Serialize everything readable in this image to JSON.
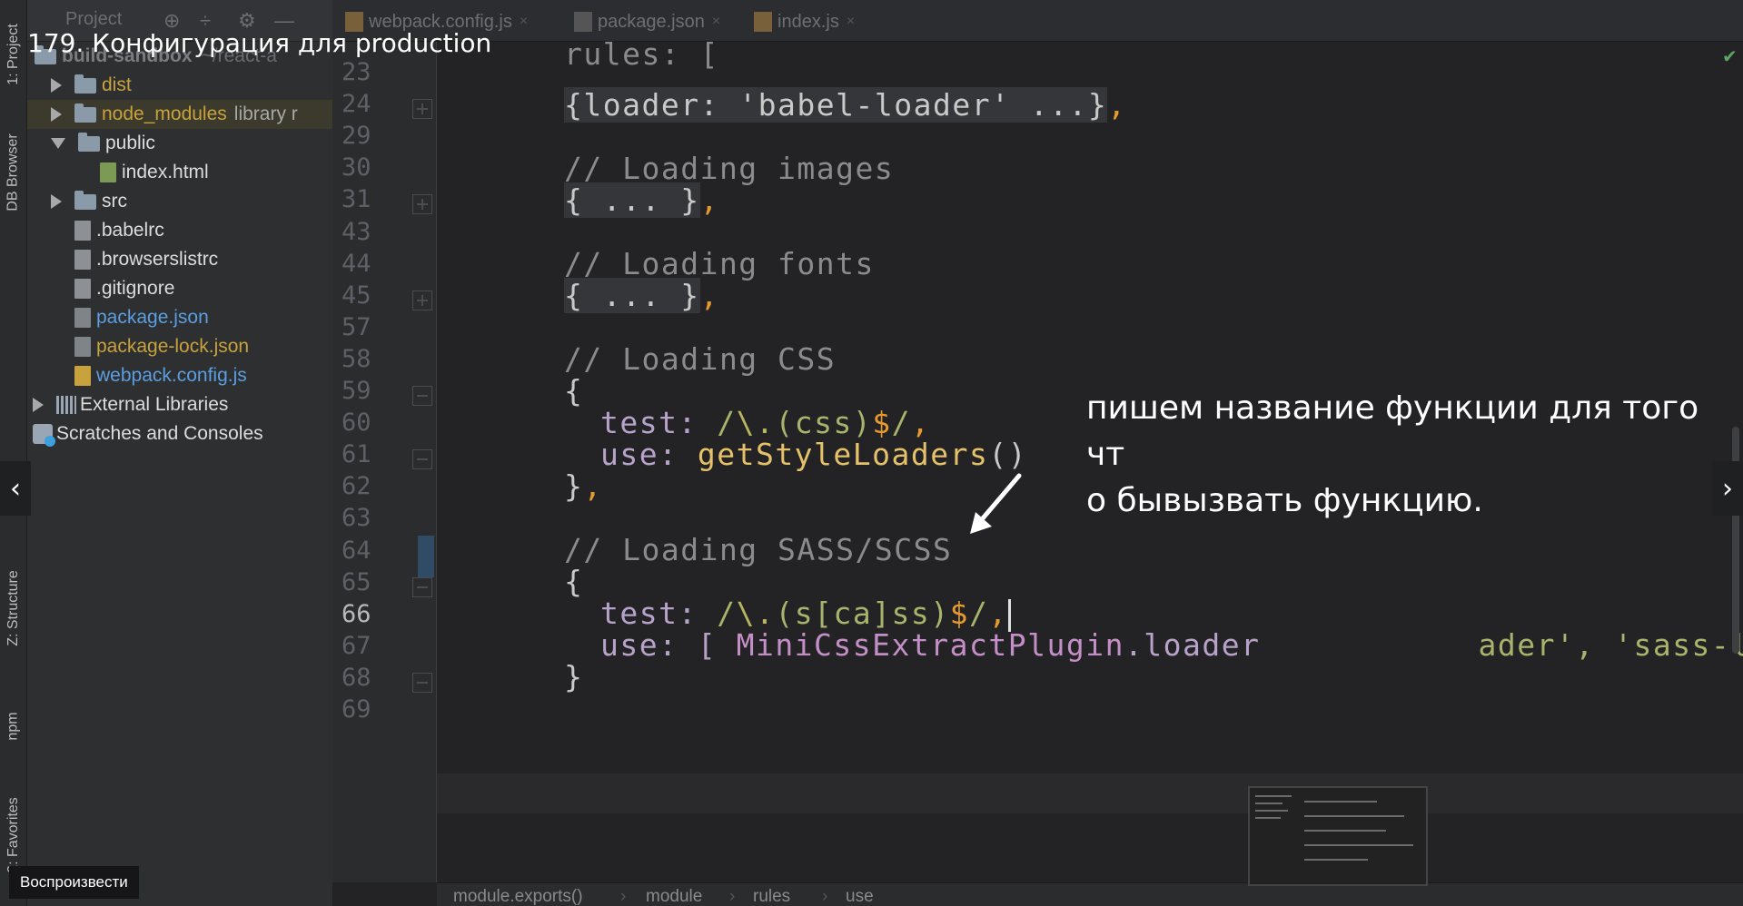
{
  "video": {
    "title": "179. Конфигурация для production",
    "annotation_line1": "пишем название функции для того чт",
    "annotation_line2": "о бывызвать функцию.",
    "play_label": "Воспроизвести"
  },
  "toolstrip": {
    "tabs": [
      "1: Project",
      "DB Browser",
      "Z: Structure",
      "npm",
      "2: Favorites"
    ]
  },
  "project": {
    "toolbar_label": "Project",
    "root_label": "build-sandbox",
    "root_path": "~/react-a",
    "tree": [
      {
        "label": "dist",
        "type": "folder",
        "expanded": false,
        "color": "#c8a23c"
      },
      {
        "label": "node_modules",
        "suffix": "library r",
        "type": "folder",
        "expanded": false,
        "color": "#c8a23c"
      },
      {
        "label": "public",
        "type": "folder",
        "expanded": true,
        "color": "#dcdcdc"
      },
      {
        "label": "index.html",
        "type": "file-html",
        "color": "#dcdcdc"
      },
      {
        "label": "src",
        "type": "folder",
        "expanded": false,
        "color": "#dcdcdc"
      },
      {
        "label": ".babelrc",
        "type": "file",
        "color": "#dcdcdc"
      },
      {
        "label": ".browserslistrc",
        "type": "file",
        "color": "#dcdcdc"
      },
      {
        "label": ".gitignore",
        "type": "file",
        "color": "#dcdcdc"
      },
      {
        "label": "package.json",
        "type": "file-json",
        "color": "#5d9ee0"
      },
      {
        "label": "package-lock.json",
        "type": "file-json",
        "color": "#c8a23c"
      },
      {
        "label": "webpack.config.js",
        "type": "file-js",
        "color": "#5d9ee0"
      },
      {
        "label": "External Libraries",
        "type": "lib",
        "color": "#dcdcdc"
      },
      {
        "label": "Scratches and Consoles",
        "type": "scratch",
        "color": "#dcdcdc"
      }
    ]
  },
  "tabs": [
    {
      "label": "webpack.config.js",
      "active": true
    },
    {
      "label": "package.json",
      "active": false
    },
    {
      "label": "index.js",
      "active": false
    }
  ],
  "gutter": {
    "lines": [
      "23",
      "24",
      "29",
      "30",
      "31",
      "43",
      "44",
      "45",
      "57",
      "58",
      "59",
      "60",
      "61",
      "62",
      "63",
      "64",
      "65",
      "66",
      "67",
      "68",
      "69"
    ],
    "current": "66"
  },
  "code": {
    "l_top": "rules: [",
    "l24_a": "{loader: 'babel-loader' ...}",
    "l24_b": ",",
    "l30": "// Loading images",
    "l31_a": "{ ... }",
    "l31_b": ",",
    "l44": "// Loading fonts",
    "l45_a": "{ ... }",
    "l45_b": ",",
    "l58": "// Loading CSS",
    "l59": "{",
    "l60_key": "test: ",
    "l60_r1": "/",
    "l60_r2": "\\.",
    "l60_r3": "(css)",
    "l60_r4": "$",
    "l60_r5": "/",
    "l60_end": ",",
    "l61_key": "use: ",
    "l61_fn": "getStyleLoaders",
    "l61_paren": "()",
    "l62_a": "}",
    "l62_b": ",",
    "l64": "// Loading SASS/SCSS",
    "l65": "{",
    "l66_key": "test: ",
    "l66_r1": "/",
    "l66_r2": "\\.",
    "l66_r3": "(s[ca]ss)",
    "l66_r4": "$",
    "l66_r5": "/",
    "l66_end": ",",
    "l67_key": "use: [ ",
    "l67_cls": "MiniCssExtractPlugin",
    "l67_prop": ".loader",
    "l67_rest": "ader', 'sass-load",
    "l68": "}"
  },
  "breadcrumb": [
    "module.exports()",
    "module",
    "rules",
    "use"
  ]
}
